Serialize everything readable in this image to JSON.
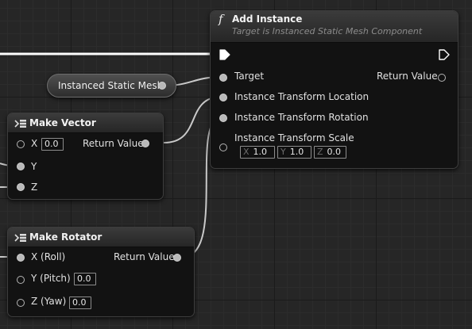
{
  "add_instance": {
    "title": "Add Instance",
    "subtitle": "Target is Instanced Static Mesh Component",
    "icon": "function-icon",
    "pins": {
      "target": "Target",
      "return_value": "Return Value",
      "location": "Instance Transform Location",
      "rotation": "Instance Transform Rotation",
      "scale": "Instance Transform Scale"
    },
    "scale_values": {
      "x_letter": "X",
      "x": "1.0",
      "y_letter": "Y",
      "y": "1.0",
      "z_letter": "Z",
      "z": "0.0"
    }
  },
  "instanced_static_mesh": {
    "label": "Instanced Static Mesh"
  },
  "make_vector": {
    "title": "Make Vector",
    "icon": "make-struct-icon",
    "pins": {
      "x": "X",
      "x_value": "0.0",
      "y": "Y",
      "z": "Z",
      "return_value": "Return Value"
    }
  },
  "make_rotator": {
    "title": "Make Rotator",
    "icon": "make-struct-icon",
    "pins": {
      "roll": "X (Roll)",
      "pitch": "Y (Pitch)",
      "pitch_value": "0.0",
      "yaw": "Z (Yaw)",
      "yaw_value": "0.0",
      "return_value": "Return Value"
    }
  },
  "colors": {
    "background": "#262626",
    "node_body": "#121212",
    "wire": "#c9c9c9",
    "exec_wire": "#ffffff",
    "pin": "#b9b9b9"
  }
}
